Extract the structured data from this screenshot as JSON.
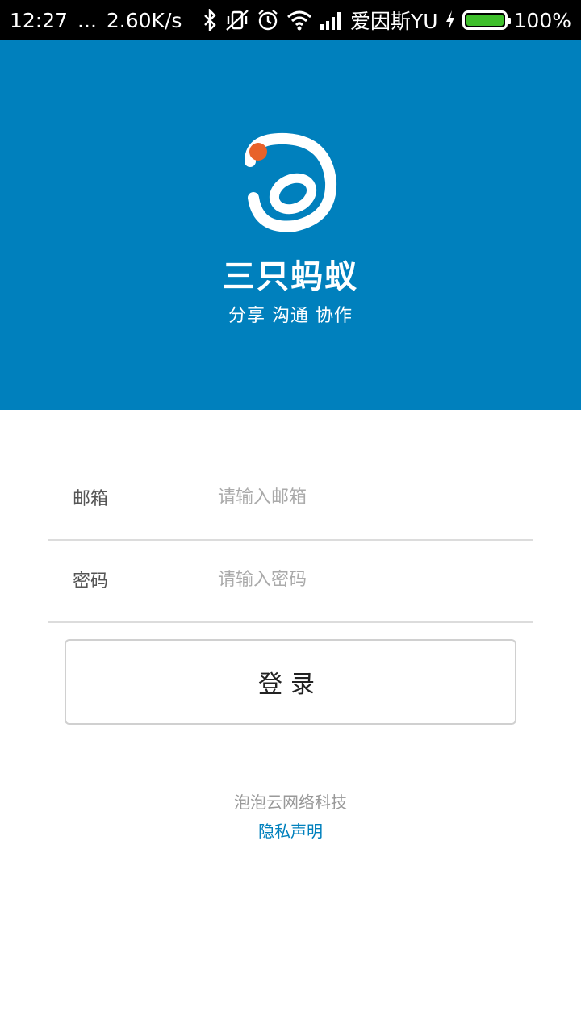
{
  "status_bar": {
    "time": "12:27",
    "more": "...",
    "net_speed": "2.60K/s",
    "carrier": "爱因斯YU",
    "battery": "100%",
    "battery_level": 1.0,
    "icons": [
      "bluetooth-icon",
      "vibrate-off-icon",
      "alarm-icon",
      "wifi-icon",
      "signal-icon",
      "charging-icon",
      "battery-icon"
    ]
  },
  "header": {
    "app_name": "三只蚂蚁",
    "slogan": "分享 沟通 协作",
    "background_color": "#0080bd",
    "logo_dot_color": "#e8622a"
  },
  "form": {
    "email_label": "邮箱",
    "email_placeholder": "请输入邮箱",
    "email_value": "",
    "password_label": "密码",
    "password_placeholder": "请输入密码",
    "password_value": "",
    "login_label": "登录"
  },
  "footer": {
    "company": "泡泡云网络科技",
    "privacy_link": "隐私声明",
    "link_color": "#0080bd"
  }
}
